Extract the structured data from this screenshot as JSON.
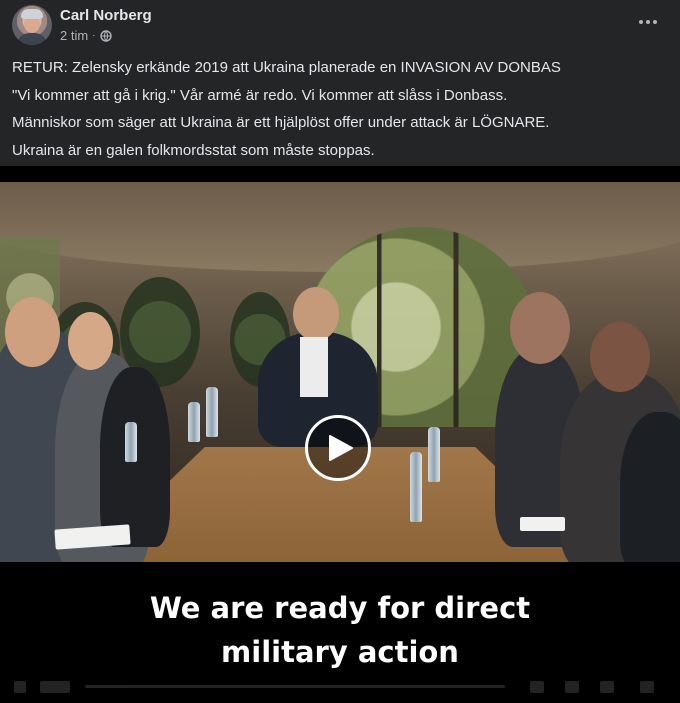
{
  "post": {
    "author": "Carl Norberg",
    "time": "2 tim",
    "separator": "·",
    "lines": [
      "RETUR: Zelensky erkände 2019 att Ukraina planerade en INVASION AV DONBAS",
      "\"Vi kommer att gå i krig.\" Vår armé är redo. Vi kommer att slåss i Donbass.",
      "Människor som säger att Ukraina är ett hjälplöst offer under attack är LÖGNARE.",
      "Ukraina är en galen folkmordsstat som måste stoppas."
    ]
  },
  "video": {
    "subtitle_line1": "We are ready for direct",
    "subtitle_line2": "military action"
  },
  "icons": {
    "privacy": "globe-icon",
    "menu": "more-horizontal-icon",
    "play": "play-icon"
  },
  "colors": {
    "background": "#242526",
    "text": "#e4e6eb",
    "secondary_text": "#b0b3b8"
  }
}
